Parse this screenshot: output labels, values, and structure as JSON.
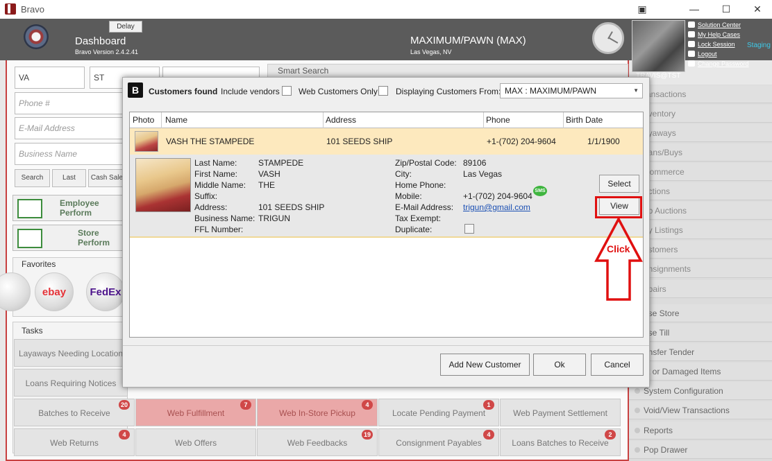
{
  "window": {
    "title": "Bravo",
    "controls": [
      "▣",
      "—",
      "☐",
      "✕"
    ]
  },
  "header": {
    "delay_label": "Delay",
    "dashboard_title": "Dashboard",
    "version": "Bravo Version 2.4.2.41",
    "store_name": "MAXIMUM/PAWN (MAX)",
    "store_location": "Las Vegas, NV",
    "user_name": "TRAVIS@TST",
    "links": [
      "Solution Center",
      "My Help Cases",
      "Lock Session",
      "Logout",
      "Change Password"
    ],
    "environment": "Staging"
  },
  "search_form": {
    "state_value": "VA",
    "state2_value": "ST",
    "phone_placeholder": "Phone #",
    "email_placeholder": "E-Mail Address",
    "business_placeholder": "Business Name",
    "smart_search_label": "Smart Search",
    "buttons": [
      "Search",
      "Last",
      "Cash Sale"
    ]
  },
  "performance": {
    "employee_label": "Employee Perform",
    "store_label": "Store Perform"
  },
  "favorites": {
    "title": "Favorites",
    "items": [
      "ebay",
      "FedEx"
    ]
  },
  "tasks": {
    "title": "Tasks",
    "left_items": [
      "Layaways Needing Location",
      "Loans Requiring Notices"
    ],
    "row1": [
      {
        "label": "Batches to Receive",
        "badge": "20"
      },
      {
        "label": "Web Fulfillment",
        "badge": "7"
      },
      {
        "label": "Web In-Store Pickup",
        "badge": "4"
      },
      {
        "label": "Locate Pending Payment",
        "badge": "1"
      },
      {
        "label": "Web Payment Settlement",
        "badge": ""
      }
    ],
    "row2": [
      {
        "label": "Web Returns",
        "badge": "4"
      },
      {
        "label": "Web Offers",
        "badge": ""
      },
      {
        "label": "Web Feedbacks",
        "badge": "19"
      },
      {
        "label": "Consignment Payables",
        "badge": "4"
      },
      {
        "label": "Loans Batches to Receive",
        "badge": "2"
      }
    ]
  },
  "sidebar": {
    "items": [
      "ransactions",
      "nventory",
      "ayaways",
      "oans/Buys",
      "Commerce",
      "uctions",
      "eb Auctions",
      "ay Listings",
      "ustomers",
      "onsignments",
      "epairs"
    ],
    "items2": [
      "ose Store",
      "ose Till",
      "ansfer Tender",
      "st or Damaged Items",
      "System Configuration",
      "Void/View Transactions",
      "Reports",
      "Pop Drawer"
    ]
  },
  "modal": {
    "title": "Customers found",
    "include_vendors_label": "Include vendors",
    "web_only_label": "Web Customers Only",
    "displaying_label": "Displaying Customers From:",
    "store_select_value": "MAX : MAXIMUM/PAWN",
    "columns": [
      "Photo",
      "Name",
      "Address",
      "Phone",
      "Birth Date"
    ],
    "row": {
      "name": "VASH THE STAMPEDE",
      "address": "101 SEEDS SHIP",
      "phone": "+1-(702) 204-9604",
      "birth_date": "1/1/1900"
    },
    "detail": {
      "labels_left": [
        "Last Name:",
        "First Name:",
        "Middle Name:",
        "Suffix:",
        "Address:",
        "Business Name:",
        "FFL Number:"
      ],
      "values_left": [
        "STAMPEDE",
        "VASH",
        "THE",
        "",
        "101 SEEDS SHIP",
        "TRIGUN",
        ""
      ],
      "labels_right": [
        "Zip/Postal Code:",
        "City:",
        "Home Phone:",
        "Mobile:",
        "E-Mail Address:",
        "Tax Exempt:",
        "Duplicate:"
      ],
      "zip": "89106",
      "city": "Las Vegas",
      "home_phone": "",
      "mobile": "+1-(702) 204-9604",
      "sms_badge": "SMS",
      "email": "trigun@gmail.com",
      "select_label": "Select",
      "view_label": "View"
    },
    "buttons": {
      "add_new": "Add New Customer",
      "ok": "Ok",
      "cancel": "Cancel"
    }
  },
  "annotation": {
    "label": "Click",
    "color": "#e01010"
  }
}
